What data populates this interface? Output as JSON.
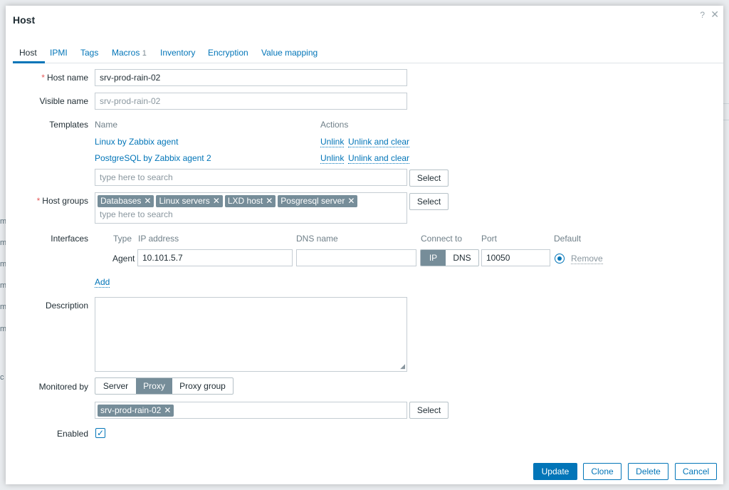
{
  "dialog": {
    "title": "Host",
    "help_icon": "?",
    "close_icon": "✕"
  },
  "tabs": [
    {
      "label": "Host"
    },
    {
      "label": "IPMI"
    },
    {
      "label": "Tags"
    },
    {
      "label": "Macros",
      "count": "1"
    },
    {
      "label": "Inventory"
    },
    {
      "label": "Encryption"
    },
    {
      "label": "Value mapping"
    }
  ],
  "host_name": {
    "label": "Host name",
    "value": "srv-prod-rain-02"
  },
  "visible_name": {
    "label": "Visible name",
    "value": "srv-prod-rain-02"
  },
  "templates": {
    "label": "Templates",
    "col_name": "Name",
    "col_actions": "Actions",
    "rows": [
      {
        "name": "Linux by Zabbix agent",
        "unlink": "Unlink",
        "unlink_clear": "Unlink and clear"
      },
      {
        "name": "PostgreSQL by Zabbix agent 2",
        "unlink": "Unlink",
        "unlink_clear": "Unlink and clear"
      }
    ],
    "search_placeholder": "type here to search",
    "select": "Select"
  },
  "host_groups": {
    "label": "Host groups",
    "chips": [
      "Databases",
      "Linux servers",
      "LXD host",
      "Posgresql server"
    ],
    "search_placeholder": "type here to search",
    "select": "Select"
  },
  "interfaces": {
    "label": "Interfaces",
    "headers": {
      "type": "Type",
      "ip": "IP address",
      "dns": "DNS name",
      "connect": "Connect to",
      "port": "Port",
      "default": "Default"
    },
    "row": {
      "type": "Agent",
      "ip": "10.101.5.7",
      "dns": "",
      "connect_ip": "IP",
      "connect_dns": "DNS",
      "port": "10050",
      "remove": "Remove"
    },
    "add": "Add"
  },
  "description": {
    "label": "Description",
    "value": ""
  },
  "monitored_by": {
    "label": "Monitored by",
    "options": [
      "Server",
      "Proxy",
      "Proxy group"
    ],
    "selected": "Proxy",
    "proxy_chip": "srv-prod-rain-02",
    "select": "Select"
  },
  "enabled": {
    "label": "Enabled",
    "checked": true,
    "check_glyph": "✓"
  },
  "footer": {
    "update": "Update",
    "clone": "Clone",
    "delete": "Delete",
    "cancel": "Cancel"
  },
  "background": {
    "left_letters": [
      "m",
      "m",
      "m",
      "m",
      "m",
      "m",
      "c"
    ]
  },
  "colors": {
    "accent": "#0275b8",
    "chip": "#768d99",
    "required": "#e45959"
  }
}
